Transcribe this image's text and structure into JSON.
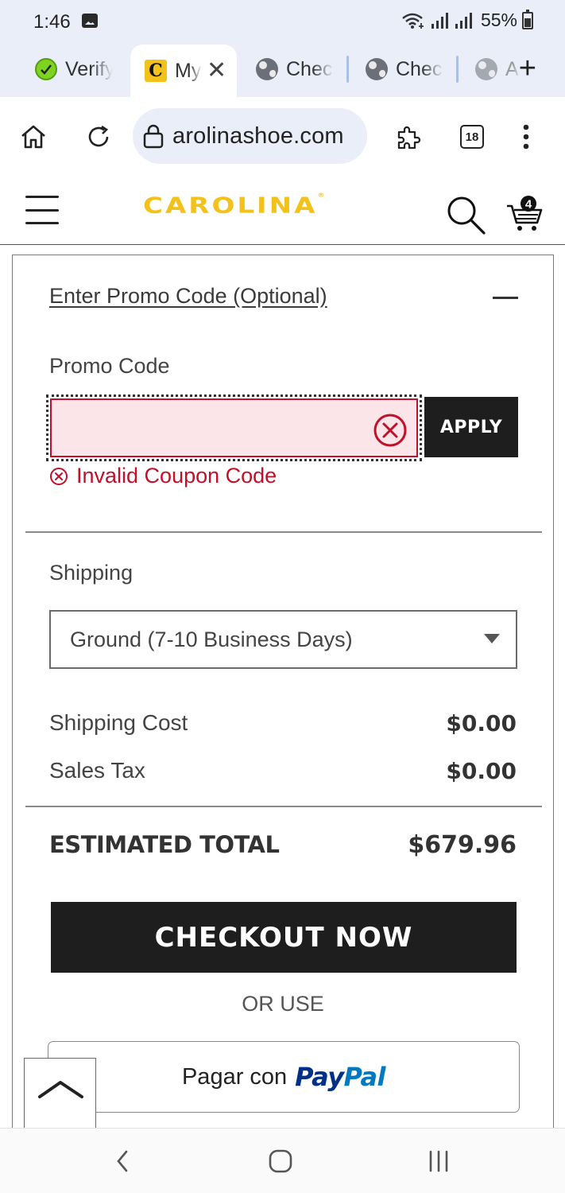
{
  "status_bar": {
    "time": "1:46",
    "battery": "55%"
  },
  "tabs": [
    {
      "title": "Verify",
      "favicon": "verify-favicon",
      "active": false
    },
    {
      "title": "My",
      "favicon": "carolina-favicon",
      "active": true
    },
    {
      "title": "Checl",
      "favicon": "globe-icon",
      "active": false
    },
    {
      "title": "Checl",
      "favicon": "globe-icon",
      "active": false
    },
    {
      "title": "A",
      "favicon": "globe-icon",
      "active": false
    }
  ],
  "browser": {
    "url": "arolinashoe.com",
    "tab_count": "18"
  },
  "site": {
    "logo_text": "CAROLINA",
    "logo_reg": "®",
    "cart_count": "4"
  },
  "promo": {
    "toggle_label": "Enter Promo Code (Optional)",
    "field_label": "Promo Code",
    "input_value": "",
    "apply_label": "APPLY",
    "error_message": "Invalid Coupon Code"
  },
  "shipping": {
    "label": "Shipping",
    "selected_option": "Ground (7-10 Business Days)"
  },
  "summary": {
    "shipping_cost_label": "Shipping Cost",
    "shipping_cost_value": "$0.00",
    "sales_tax_label": "Sales Tax",
    "sales_tax_value": "$0.00",
    "total_label": "ESTIMATED TOTAL",
    "total_value": "$679.96"
  },
  "actions": {
    "checkout_label": "CHECKOUT NOW",
    "or_use_label": "OR USE",
    "paypal_prefix": "Pagar con",
    "paypal_pay": "Pay",
    "paypal_pal": "Pal"
  },
  "colors": {
    "brand_yellow": "#f2c21b",
    "error_red": "#c0102a",
    "button_dark": "#1e1e1e",
    "chrome_bg": "#e9eef8"
  }
}
